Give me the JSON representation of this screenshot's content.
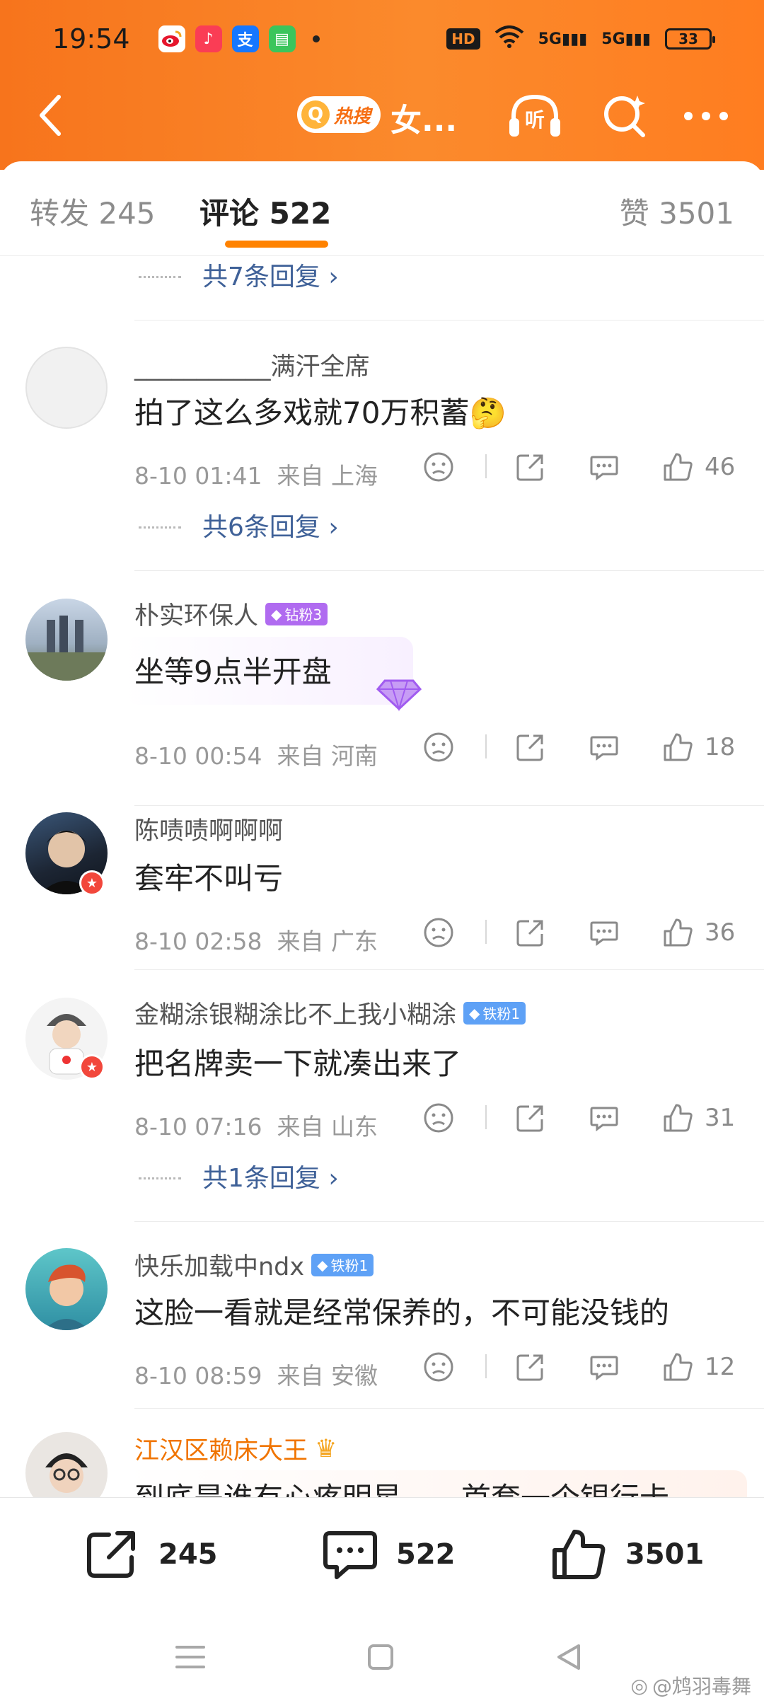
{
  "status_bar": {
    "time": "19:54",
    "network": "5G",
    "battery": "33"
  },
  "header": {
    "hot_search_label": "热搜",
    "title": "女...",
    "listen_label": "听"
  },
  "tabs": {
    "repost": "转发 245",
    "comments": "评论 522",
    "likes": "赞 3501"
  },
  "top_reply_more": "共7条回复",
  "comments": [
    {
      "user": "___________满汗全席",
      "text": "拍了这么多戏就70万积蓄",
      "emoji": "🤔",
      "time": "8-10 01:41",
      "location": "来自 上海",
      "likes": "46",
      "replies": "共6条回复"
    },
    {
      "user": "朴实环保人",
      "badge": "钻粉3",
      "text": "坐等9点半开盘",
      "time": "8-10 00:54",
      "location": "来自 河南",
      "likes": "18"
    },
    {
      "user": "陈啧啧啊啊啊",
      "text": "套牢不叫亏",
      "time": "8-10 02:58",
      "location": "来自 广东",
      "likes": "36"
    },
    {
      "user": "金糊涂银糊涂比不上我小糊涂",
      "badge": "铁粉1",
      "text": "把名牌卖一下就凑出来了",
      "time": "8-10 07:16",
      "location": "来自 山东",
      "likes": "31",
      "replies": "共1条回复"
    },
    {
      "user": "快乐加载中ndx",
      "badge": "铁粉1",
      "text": "这脸一看就是经常保养的，不可能没钱的",
      "time": "8-10 08:59",
      "location": "来自 安徽",
      "likes": "12"
    },
    {
      "user": "江汉区赖床大王",
      "text": "到底是谁有心疼明星……首套一个银行卡"
    }
  ],
  "bottom_bar": {
    "repost_count": "245",
    "comment_count": "522",
    "like_count": "3501"
  },
  "watermark": "@鸩羽毒舞",
  "colors": {
    "accent": "#ff8200",
    "header_gradient_start": "#f7741c",
    "link": "#3f6198",
    "muted": "#999999"
  }
}
